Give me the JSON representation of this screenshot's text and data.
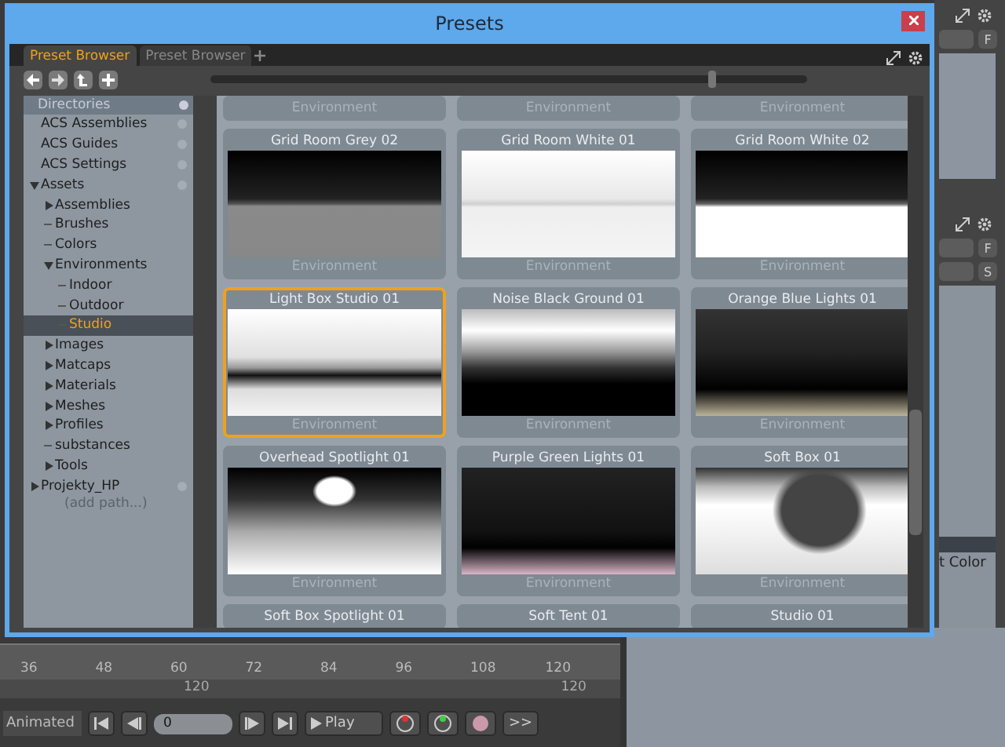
{
  "window": {
    "title": "Presets"
  },
  "tabs": [
    {
      "label": "Preset Browser",
      "selected": true
    },
    {
      "label": "Preset Browser",
      "selected": false
    }
  ],
  "size_slider": {
    "level": 0.84
  },
  "directories": {
    "title": "Directories",
    "items": [
      {
        "label": "ACS Assemblies",
        "kind": "plain",
        "selected": false
      },
      {
        "label": "ACS Guides",
        "kind": "plain",
        "selected": false
      },
      {
        "label": "ACS Settings",
        "kind": "plain",
        "selected": false
      },
      {
        "label": "Assets",
        "kind": "branch",
        "expanded": true,
        "selected": false,
        "children": [
          {
            "label": "Assemblies",
            "kind": "branch",
            "expanded": false,
            "selected": false
          },
          {
            "label": "Brushes",
            "kind": "leaf",
            "selected": false
          },
          {
            "label": "Colors",
            "kind": "leaf",
            "selected": false
          },
          {
            "label": "Environments",
            "kind": "branch",
            "expanded": true,
            "selected": false,
            "children": [
              {
                "label": "Indoor",
                "kind": "leaf",
                "selected": false
              },
              {
                "label": "Outdoor",
                "kind": "leaf",
                "selected": false
              },
              {
                "label": "Studio",
                "kind": "leaf",
                "selected": true
              }
            ]
          },
          {
            "label": "Images",
            "kind": "branch",
            "expanded": false,
            "selected": false
          },
          {
            "label": "Matcaps",
            "kind": "branch",
            "expanded": false,
            "selected": false
          },
          {
            "label": "Materials",
            "kind": "branch",
            "expanded": false,
            "selected": false
          },
          {
            "label": "Meshes",
            "kind": "branch",
            "expanded": false,
            "selected": false
          },
          {
            "label": "Profiles",
            "kind": "branch",
            "expanded": false,
            "selected": false
          },
          {
            "label": "substances",
            "kind": "leaf",
            "selected": false
          },
          {
            "label": "Tools",
            "kind": "branch",
            "expanded": false,
            "selected": false
          }
        ]
      },
      {
        "label": "Projekty_HP",
        "kind": "branch",
        "expanded": false,
        "selected": false
      }
    ],
    "add_path": "(add path...)"
  },
  "presets": [
    {
      "footer": "Environment",
      "selected": false
    },
    {
      "footer": "Environment",
      "selected": false
    },
    {
      "footer": "Environment",
      "selected": false
    },
    {
      "title": "Grid Room Grey 02",
      "kind": "grid-dark",
      "footer": "Environment",
      "selected": false
    },
    {
      "title": "Grid Room White 01",
      "kind": "grid-white",
      "footer": "Environment",
      "selected": false
    },
    {
      "title": "Grid Room White 02",
      "kind": "grid-dark-white",
      "footer": "Environment",
      "selected": false
    },
    {
      "title": "Light Box Studio 01",
      "kind": "lightbox",
      "footer": "Environment",
      "selected": true
    },
    {
      "title": "Noise Black Ground 01",
      "kind": "noise",
      "footer": "Environment",
      "selected": false
    },
    {
      "title": "Orange Blue Lights 01",
      "kind": "lights-yellow",
      "footer": "Environment",
      "selected": false
    },
    {
      "title": "Overhead Spotlight 01",
      "kind": "spotlight",
      "footer": "Environment",
      "selected": false
    },
    {
      "title": "Purple Green Lights 01",
      "kind": "lights-pink",
      "footer": "Environment",
      "selected": false
    },
    {
      "title": "Soft Box 01",
      "kind": "softbox",
      "footer": "Environment",
      "selected": false
    },
    {
      "title": "Soft Box Spotlight 01",
      "selected": false
    },
    {
      "title": "Soft Tent 01",
      "selected": false
    },
    {
      "title": "Studio 01",
      "selected": false
    }
  ],
  "side_panel": {
    "buttons": [
      "F",
      "F",
      "S"
    ],
    "row_text": "t Color"
  },
  "timeline": {
    "ticks": [
      "36",
      "48",
      "60",
      "72",
      "84",
      "96",
      "108",
      "120"
    ],
    "range_end": [
      "120",
      "120"
    ]
  },
  "transport": {
    "mode": "Animated",
    "frame": "0",
    "play": "Play",
    "more": ">>"
  }
}
